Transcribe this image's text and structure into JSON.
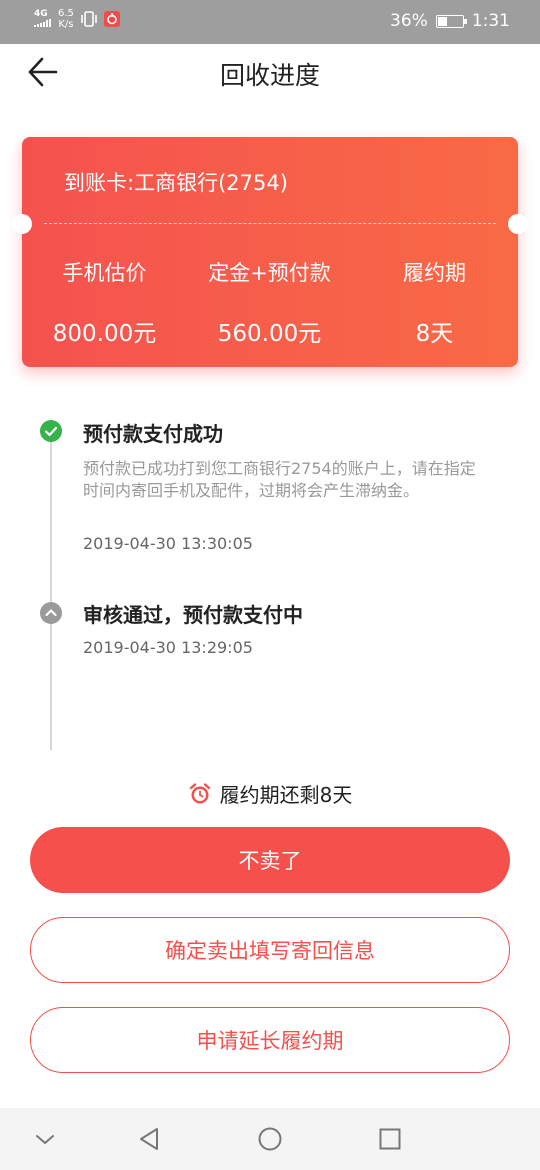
{
  "status_bar": {
    "signal": "4G",
    "net_speed_value": "6.5",
    "net_speed_unit": "K/s",
    "battery_percent": "36%",
    "battery_level": 0.36,
    "time": "1:31"
  },
  "header": {
    "title": "回收进度",
    "back_icon": "arrow-left-icon"
  },
  "card": {
    "bank": "到账卡:工商银行(2754)",
    "columns": [
      {
        "label": "手机估价",
        "value": "800.00元"
      },
      {
        "label": "定金+预付款",
        "value": "560.00元"
      },
      {
        "label": "履约期",
        "value": "8天"
      }
    ],
    "colors": {
      "start": "#f5524f",
      "end": "#f86a45"
    }
  },
  "timeline": [
    {
      "status": "done",
      "icon": "check-circle-icon",
      "title": "预付款支付成功",
      "description": "预付款已成功打到您工商银行2754的账户上，请在指定时间内寄回手机及配件，过期将会产生滞纳金。",
      "time": "2019-04-30 13:30:05"
    },
    {
      "status": "past",
      "icon": "chevron-up-circle-icon",
      "title": "审核通过，预付款支付中",
      "time": "2019-04-30 13:29:05"
    }
  ],
  "countdown": {
    "icon": "alarm-clock-icon",
    "text": "履约期还剩8天"
  },
  "buttons": {
    "cancel_sale": "不卖了",
    "confirm_sale": "确定卖出填写寄回信息",
    "extend": "申请延长履约期"
  },
  "accent_color": "#f5504c",
  "nav_bar": {
    "icons": [
      "chevron-down-icon",
      "back-triangle-icon",
      "home-circle-icon",
      "recents-square-icon"
    ]
  }
}
